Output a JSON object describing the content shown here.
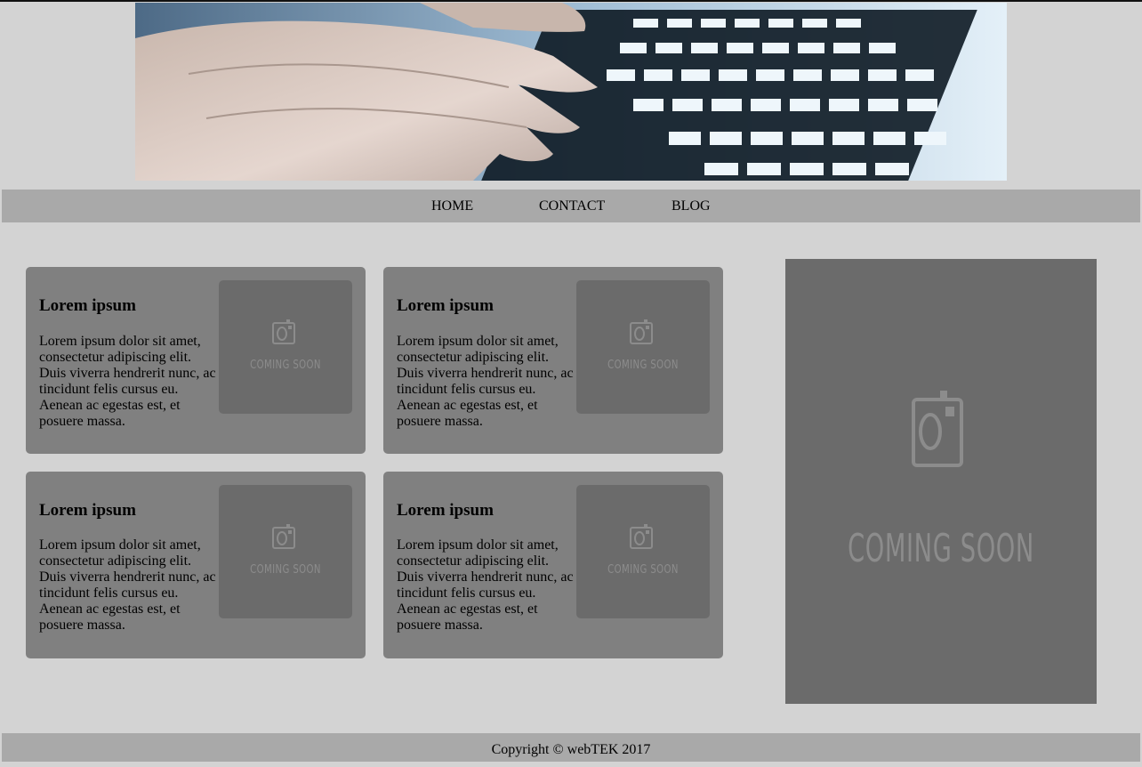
{
  "nav": {
    "items": [
      {
        "label": "HOME"
      },
      {
        "label": "CONTACT"
      },
      {
        "label": "BLOG"
      }
    ]
  },
  "cards": [
    {
      "title": "Lorem ipsum",
      "text": "Lorem ipsum dolor sit amet, consectetur adipiscing elit. Duis viverra hendrerit nunc, ac tincidunt felis cursus eu. Aenean ac egestas est, et posuere massa.",
      "image_text": "COMING SOON"
    },
    {
      "title": "Lorem ipsum",
      "text": "Lorem ipsum dolor sit amet, consectetur adipiscing elit. Duis viverra hendrerit nunc, ac tincidunt felis cursus eu. Aenean ac egestas est, et posuere massa.",
      "image_text": "COMING SOON"
    },
    {
      "title": "Lorem ipsum",
      "text": "Lorem ipsum dolor sit amet, consectetur adipiscing elit. Duis viverra hendrerit nunc, ac tincidunt felis cursus eu. Aenean ac egestas est, et posuere massa.",
      "image_text": "COMING SOON"
    },
    {
      "title": "Lorem ipsum",
      "text": "Lorem ipsum dolor sit amet, consectetur adipiscing elit. Duis viverra hendrerit nunc, ac tincidunt felis cursus eu. Aenean ac egestas est, et posuere massa.",
      "image_text": "COMING SOON"
    }
  ],
  "sidebar": {
    "image_text": "COMING SOON"
  },
  "footer": {
    "copyright": "Copyright © webTEK 2017"
  },
  "icons": {
    "banner": "keyboard-typing-photo",
    "placeholder": "camera-icon"
  },
  "colors": {
    "background": "#d3d3d3",
    "navbar": "#a9a9a9",
    "card": "#808080",
    "placeholder": "#6b6b6b",
    "placeholder_text": "#8c8c8c"
  }
}
